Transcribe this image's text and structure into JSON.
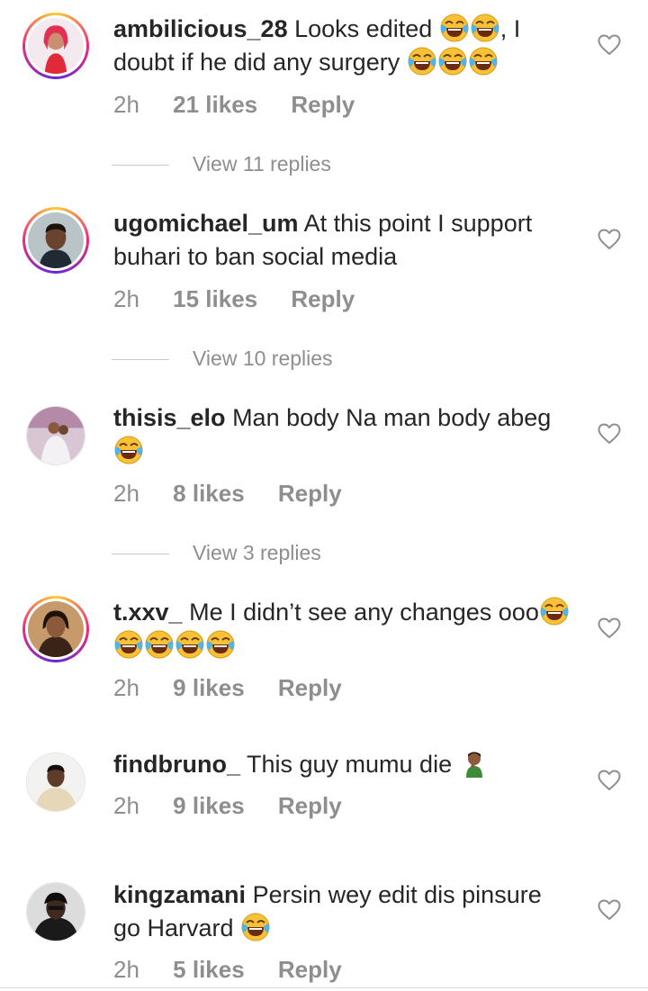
{
  "comments": [
    {
      "username": "ambilicious_28",
      "text": "Looks edited",
      "text_after": ", I doubt if he did any surgery",
      "time": "2h",
      "likes": "21 likes",
      "reply": "Reply",
      "view_replies": "View 11 replies"
    },
    {
      "username": "ugomichael_um",
      "text": "At this point I support buhari to ban social media",
      "time": "2h",
      "likes": "15 likes",
      "reply": "Reply",
      "view_replies": "View 10 replies"
    },
    {
      "username": "thisis_elo",
      "text": "Man body Na man body abeg",
      "time": "2h",
      "likes": "8 likes",
      "reply": "Reply",
      "view_replies": "View 3 replies"
    },
    {
      "username": "t.xxv_",
      "text": "Me I didn’t see any changes ooo",
      "time": "2h",
      "likes": "9 likes",
      "reply": "Reply"
    },
    {
      "username": "findbruno_",
      "text": "This guy mumu die",
      "time": "2h",
      "likes": "9 likes",
      "reply": "Reply"
    },
    {
      "username": "kingzamani",
      "text": "Persin wey edit dis pinsure go Harvard",
      "time": "2h",
      "likes": "5 likes",
      "reply": "Reply"
    }
  ],
  "icons": {
    "like": "heart-outline-icon",
    "laugh": "face-with-tears-of-joy-emoji",
    "facepalm": "man-facepalming-emoji"
  },
  "colors": {
    "text": "#262626",
    "secondary": "#8e8e8e",
    "story_ring": "#ee2a7b",
    "emoji_yellow": "#f7c236"
  }
}
